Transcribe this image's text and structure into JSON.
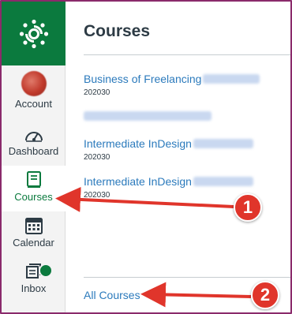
{
  "nav": {
    "items": [
      {
        "key": "account",
        "label": "Account",
        "icon": "avatar"
      },
      {
        "key": "dashboard",
        "label": "Dashboard",
        "icon": "dashboard-icon"
      },
      {
        "key": "courses",
        "label": "Courses",
        "icon": "book-icon",
        "active": true
      },
      {
        "key": "calendar",
        "label": "Calendar",
        "icon": "calendar-icon"
      },
      {
        "key": "inbox",
        "label": "Inbox",
        "icon": "inbox-icon"
      }
    ]
  },
  "tray": {
    "title": "Courses",
    "courses": [
      {
        "name": "Business of Freelancing",
        "term": "202030"
      },
      {
        "name": "",
        "term": ""
      },
      {
        "name": "Intermediate InDesign",
        "term": "202030"
      },
      {
        "name": "Intermediate InDesign",
        "term": "202030"
      }
    ],
    "all_courses_label": "All Courses"
  },
  "annotations": [
    {
      "label": "1"
    },
    {
      "label": "2"
    }
  ],
  "colors": {
    "brand": "#0b7a3e",
    "link": "#2b7abc",
    "annotation": "#e0352b",
    "frame": "#8a2a6b"
  }
}
